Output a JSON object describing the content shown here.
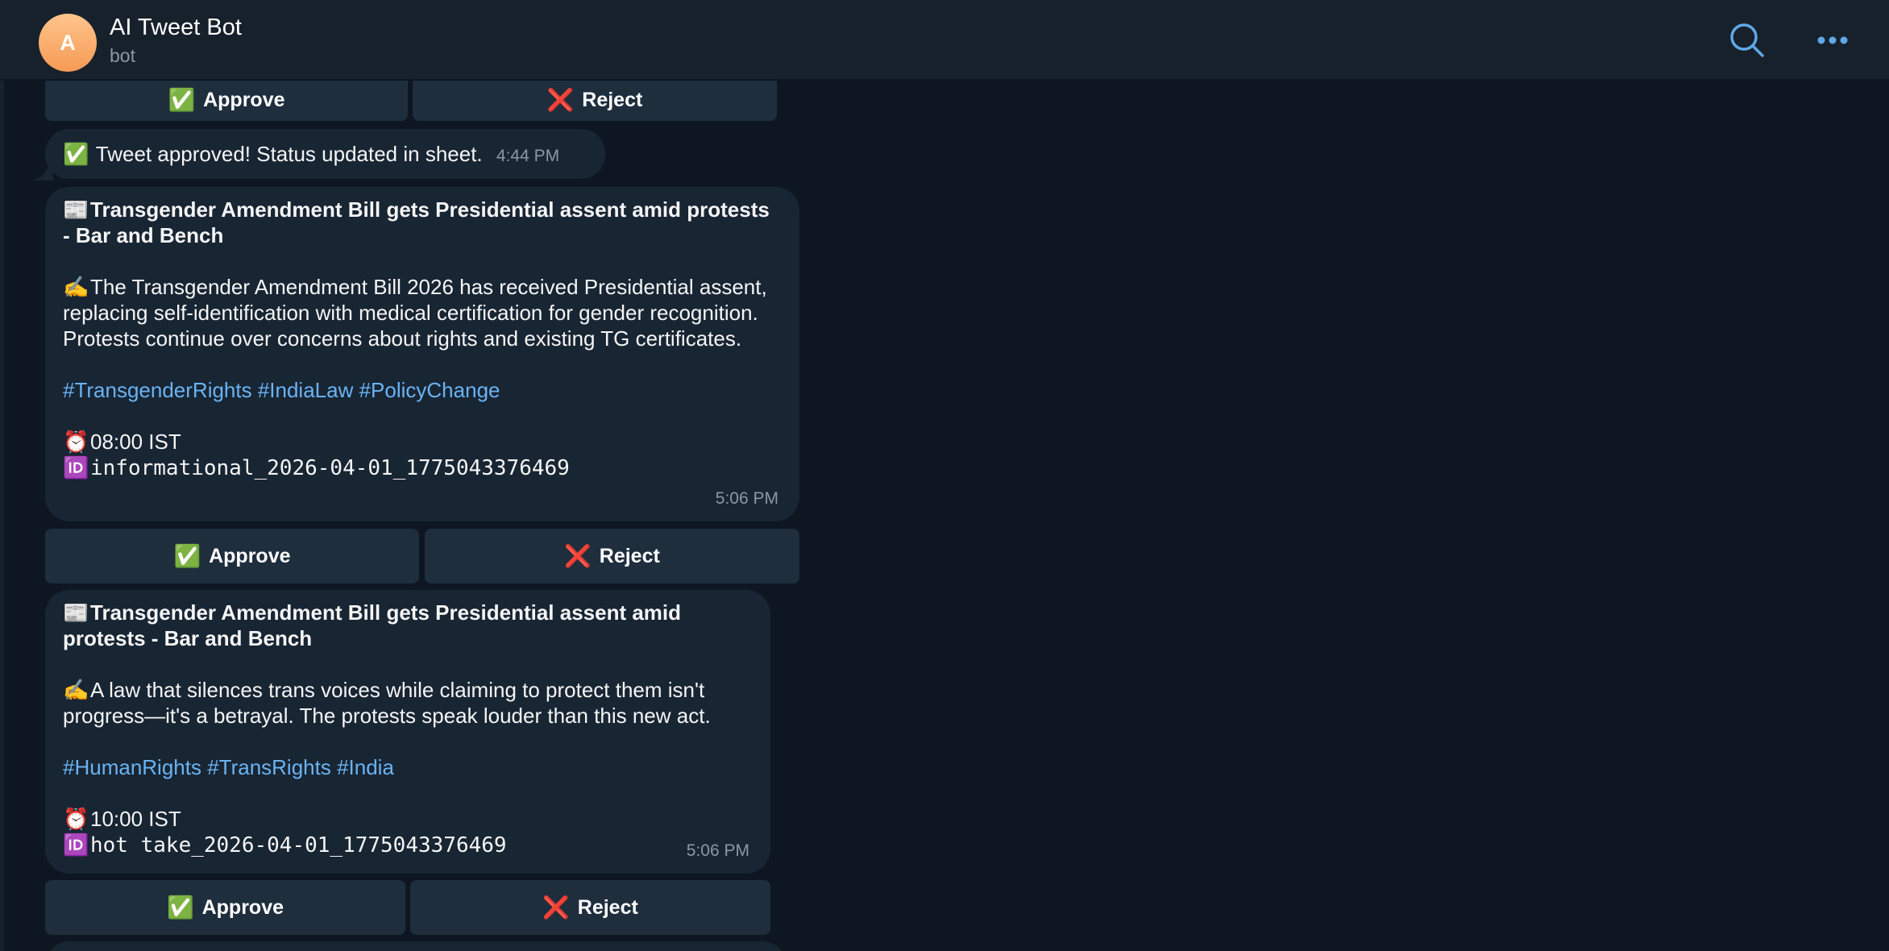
{
  "header": {
    "avatar_letter": "A",
    "title": "AI Tweet Bot",
    "subtitle": "bot",
    "icons": [
      "search-icon",
      "more-icon"
    ]
  },
  "buttons": {
    "approve_label": "Approve",
    "reject_label": "Reject",
    "approve_icon": "✅",
    "reject_icon": "❌"
  },
  "status_message": {
    "icon": "✅",
    "text": "Tweet approved! Status updated in sheet.",
    "time": "4:44 PM"
  },
  "messages": [
    {
      "headline_icon": "📰",
      "headline": "Transgender Amendment Bill gets Presidential assent amid protests - Bar and Bench",
      "body_icon": "✍️",
      "body": "The Transgender Amendment Bill 2026 has received Presidential assent, replacing self-identification with medical certification for gender recognition. Protests continue over concerns about rights and existing TG certificates.",
      "hashtags": "#TransgenderRights #IndiaLaw #PolicyChange",
      "schedule_icon": "⏰",
      "schedule": "08:00 IST",
      "id_icon": "🆔",
      "id": "informational_2026-04-01_1775043376469",
      "time": "5:06 PM"
    },
    {
      "headline_icon": "📰",
      "headline": "Transgender Amendment Bill gets Presidential assent amid protests - Bar and Bench",
      "body_icon": "✍️",
      "body": "A law that silences trans voices while claiming to protect them isn't progress—it's a betrayal. The protests speak louder than this new act.",
      "hashtags": "#HumanRights #TransRights #India",
      "schedule_icon": "⏰",
      "schedule": "10:00 IST",
      "id_icon": "🆔",
      "id": "hot take_2026-04-01_1775043376469",
      "time": "5:06 PM"
    }
  ],
  "colors": {
    "background": "#0e1621",
    "header": "#17212b",
    "bubble": "#182533",
    "button": "#1f2e3d",
    "link": "#6ab3f3",
    "accent": "#5fa8e8"
  }
}
